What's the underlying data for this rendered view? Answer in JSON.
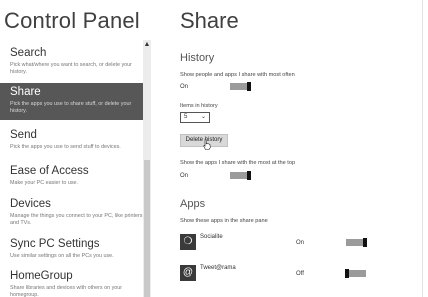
{
  "control_panel": {
    "title": "Control Panel",
    "nav_items": [
      {
        "title": "Search",
        "desc": "Pick what/where you want to search, or delete your history."
      },
      {
        "title": "Share",
        "desc": "Pick the apps you use to share stuff, or delete your history."
      },
      {
        "title": "Send",
        "desc": "Pick the apps you use to send stuff to devices."
      },
      {
        "title": "Ease of Access",
        "desc": "Make your PC easier to use."
      },
      {
        "title": "Devices",
        "desc": "Manage the things you connect to your PC, like printers and TVs."
      },
      {
        "title": "Sync PC Settings",
        "desc": "Use similar settings on all the PCs you use."
      },
      {
        "title": "HomeGroup",
        "desc": "Share libraries and devices with others on your homegroup."
      }
    ],
    "selected_index": 1
  },
  "share": {
    "title": "Share",
    "history": {
      "section_title": "History",
      "show_frequent_label": "Show people and apps I share with most often",
      "show_frequent_state": "On",
      "items_label": "Items in history",
      "items_value": "5",
      "delete_button": "Delete history"
    },
    "top_apps": {
      "label": "Show the apps I share with the most at the top",
      "state": "On"
    },
    "apps": {
      "section_title": "Apps",
      "label": "Show these apps in the share pane",
      "list": [
        {
          "name": "Socialite",
          "state": "On",
          "icon": "socialite-icon",
          "glyph": "❍"
        },
        {
          "name": "Tweet@rama",
          "state": "Off",
          "icon": "tweetrama-icon",
          "glyph": "@"
        }
      ]
    }
  },
  "colors": {
    "selected_nav_bg": "#575757",
    "toggle_track": "#9b9b9b",
    "toggle_knob": "#111111"
  }
}
